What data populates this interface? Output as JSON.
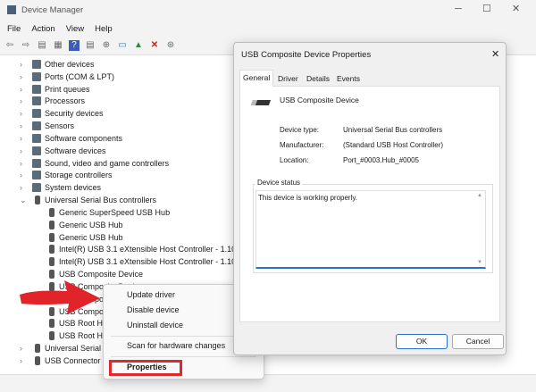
{
  "window": {
    "title": "Device Manager",
    "controls": [
      "minimize",
      "maximize",
      "close"
    ]
  },
  "menu": [
    "File",
    "Action",
    "View",
    "Help"
  ],
  "toolbar": [
    "back-icon",
    "forward-icon",
    "show-hide-icon",
    "properties-icon",
    "help-icon",
    "view-icon",
    "scan-icon",
    "monitor-icon",
    "enable-icon",
    "uninstall-icon",
    "update-icon"
  ],
  "tree": {
    "top": [
      {
        "label": "Other devices"
      },
      {
        "label": "Ports (COM & LPT)"
      },
      {
        "label": "Print queues"
      },
      {
        "label": "Processors"
      },
      {
        "label": "Security devices"
      },
      {
        "label": "Sensors"
      },
      {
        "label": "Software components"
      },
      {
        "label": "Software devices"
      },
      {
        "label": "Sound, video and game controllers"
      },
      {
        "label": "Storage controllers"
      },
      {
        "label": "System devices"
      }
    ],
    "expanded": {
      "label": "Universal Serial Bus controllers",
      "children": [
        "Generic SuperSpeed USB Hub",
        "Generic USB Hub",
        "Generic USB Hub",
        "Intel(R) USB 3.1 eXtensible Host Controller - 1.10",
        "Intel(R) USB 3.1 eXtensible Host Controller - 1.10",
        "USB Composite Device",
        "USB Composite Device",
        "USB Compo",
        "USB Compo",
        "USB Root H",
        "USB Root H"
      ]
    },
    "bottom": [
      {
        "label": "Universal Serial"
      },
      {
        "label": "USB Connector"
      }
    ]
  },
  "context_menu": {
    "items": [
      "Update driver",
      "Disable device",
      "Uninstall device",
      "Scan for hardware changes",
      "Properties"
    ],
    "highlight_color": "#e0292f"
  },
  "dialog": {
    "title": "USB Composite Device Properties",
    "tabs": [
      "General",
      "Driver",
      "Details",
      "Events"
    ],
    "active_tab": "General",
    "device_name": "USB Composite Device",
    "fields": [
      {
        "label": "Device type:",
        "value": "Universal Serial Bus controllers"
      },
      {
        "label": "Manufacturer:",
        "value": "(Standard USB Host Controller)"
      },
      {
        "label": "Location:",
        "value": "Port_#0003.Hub_#0005"
      }
    ],
    "status_label": "Device status",
    "status_text": "This device is working properly.",
    "ok": "OK",
    "cancel": "Cancel"
  }
}
